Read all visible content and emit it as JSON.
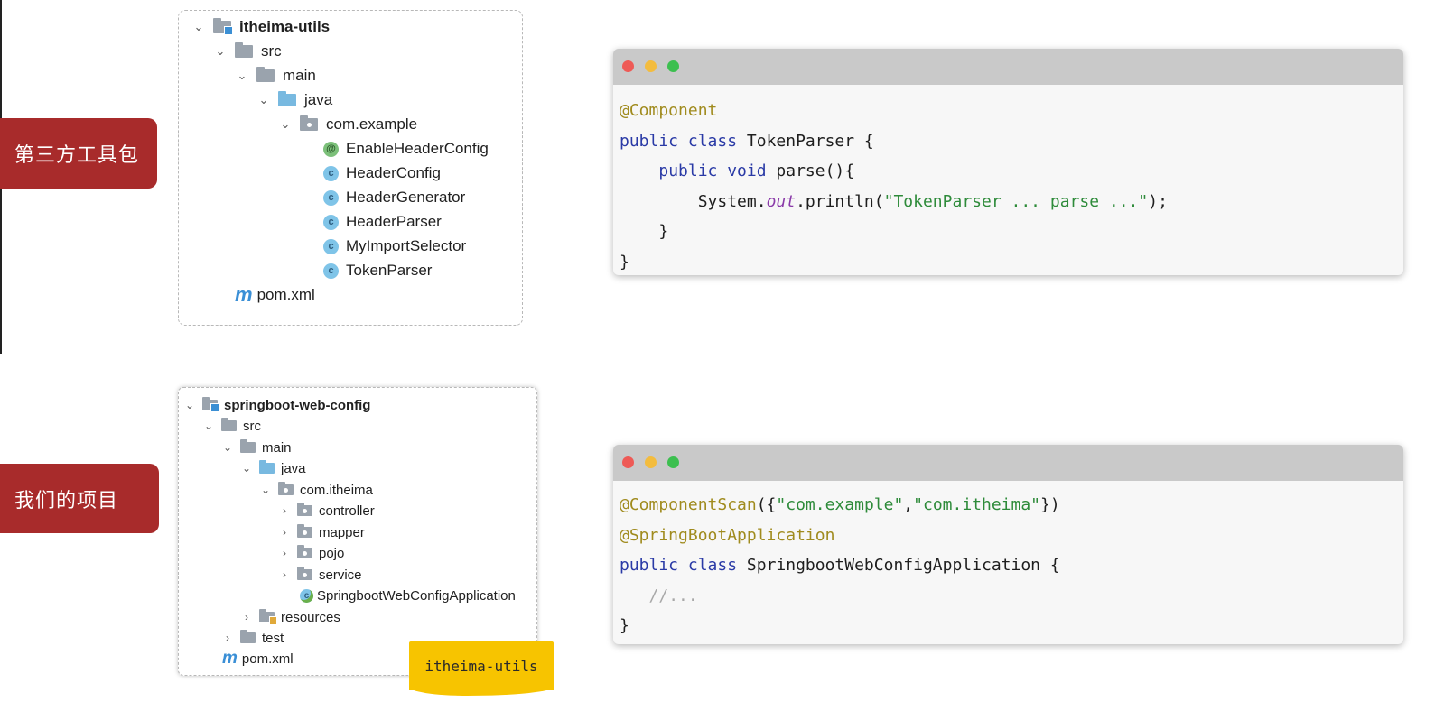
{
  "tags": {
    "third_party": "第三方工具包",
    "our_project": "我们的项目"
  },
  "tree1": {
    "project": "itheima-utils",
    "src": "src",
    "main": "main",
    "java": "java",
    "package": "com.example",
    "files": [
      "EnableHeaderConfig",
      "HeaderConfig",
      "HeaderGenerator",
      "HeaderParser",
      "MyImportSelector",
      "TokenParser"
    ],
    "pom": "pom.xml"
  },
  "tree2": {
    "project": "springboot-web-config",
    "src": "src",
    "main": "main",
    "java": "java",
    "package": "com.itheima",
    "folders": [
      "controller",
      "mapper",
      "pojo",
      "service"
    ],
    "app_class": "SpringbootWebConfigApplication",
    "resources": "resources",
    "test": "test",
    "pom": "pom.xml"
  },
  "code1": {
    "annotation": "@Component",
    "l2_kw": "public class ",
    "l2_name": "TokenParser {",
    "l3_indent": "    ",
    "l3_kw": "public void ",
    "l3_name": "parse(){",
    "l4_indent": "        ",
    "l4_a": "System.",
    "l4_field": "out",
    "l4_b": ".println(",
    "l4_str": "\"TokenParser ... parse ...\"",
    "l4_c": ");",
    "l5": "    }",
    "l6": "}"
  },
  "code2": {
    "l1_anno": "@ComponentScan",
    "l1_a": "({",
    "l1_s1": "\"com.example\"",
    "l1_comma": ",",
    "l1_s2": "\"com.itheima\"",
    "l1_b": "})",
    "l2_anno": "@SpringBootApplication",
    "l3_kw": "public class ",
    "l3_name": "SpringbootWebConfigApplication {",
    "l4_indent": "   ",
    "l4_comment": "//...",
    "l5": "}"
  },
  "sticker": "itheima-utils",
  "icons": {
    "folder": "folder-icon",
    "class": "class-icon",
    "annotation": "annotation-icon",
    "maven": "maven-icon",
    "chevron_down": "chevron-down-icon",
    "chevron_right": "chevron-right-icon"
  },
  "colors": {
    "tag_red": "#a82b2b",
    "sticker_yellow": "#f7c400"
  }
}
